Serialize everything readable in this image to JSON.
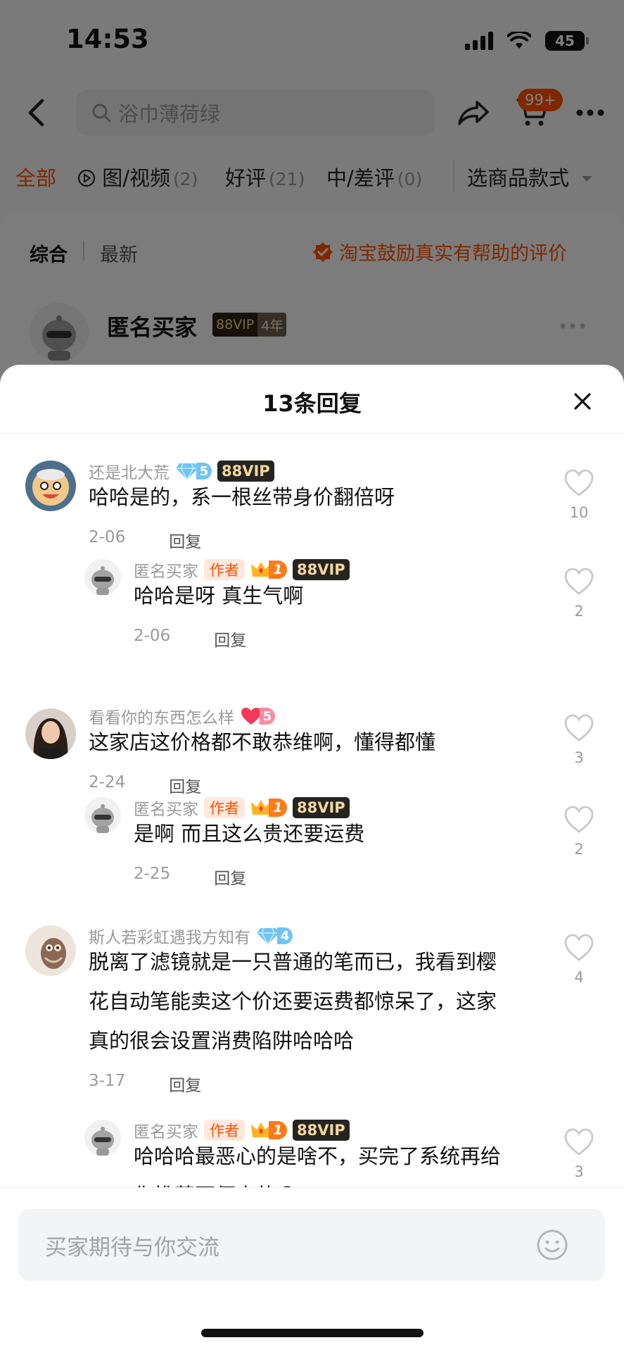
{
  "status_bar": {
    "time": "14:53",
    "battery": "45"
  },
  "nav": {
    "search_placeholder": "浴巾薄荷绿",
    "cart_badge": "99+"
  },
  "filter_tabs": [
    {
      "label": "全部",
      "count": ""
    },
    {
      "label": "图/视频",
      "count": "(2)"
    },
    {
      "label": "好评",
      "count": "(21)"
    },
    {
      "label": "中/差评",
      "count": "(0)"
    }
  ],
  "style_select_label": "选商品款式",
  "sort": {
    "active": "综合",
    "latest": "最新",
    "encourage": "淘宝鼓励真实有帮助的评价"
  },
  "reviewer": {
    "name": "匿名买家",
    "vip": "88VIP",
    "years": "4年"
  },
  "sheet": {
    "title": "13条回复",
    "replies": [
      {
        "user": "还是北大荒",
        "level": "5",
        "level_type": "diamond",
        "vip": "88VIP",
        "author": false,
        "text": "哈哈是的，系一根丝带身价翻倍呀",
        "date": "2-06",
        "reply_label": "回复",
        "likes": "10"
      },
      {
        "user": "匿名买家",
        "author_label": "作者",
        "level": "1",
        "level_type": "crown",
        "vip": "88VIP",
        "author": true,
        "text": "哈哈是呀 真生气啊",
        "date": "2-06",
        "reply_label": "回复",
        "likes": "2"
      },
      {
        "user": "看看你的东西怎么样",
        "level": "5",
        "level_type": "heart",
        "vip": "",
        "author": false,
        "text": "这家店这价格都不敢恭维啊，懂得都懂",
        "date": "2-24",
        "reply_label": "回复",
        "likes": "3"
      },
      {
        "user": "匿名买家",
        "author_label": "作者",
        "level": "1",
        "level_type": "crown",
        "vip": "88VIP",
        "author": true,
        "text": "是啊 而且这么贵还要运费",
        "date": "2-25",
        "reply_label": "回复",
        "likes": "2"
      },
      {
        "user": "斯人若彩虹遇我方知有",
        "level": "4",
        "level_type": "diamond",
        "vip": "",
        "author": false,
        "text_lines": [
          "脱离了滤镜就是一只普通的笔而已，我看到樱",
          "花自动笔能卖这个价还要运费都惊呆了，这家",
          "真的很会设置消费陷阱哈哈哈"
        ],
        "date": "3-17",
        "reply_label": "回复",
        "likes": "4"
      },
      {
        "user": "匿名买家",
        "author_label": "作者",
        "level": "1",
        "level_type": "crown",
        "vip": "88VIP",
        "author": true,
        "text_lines": [
          "哈哈哈最恶心的是啥不，买完了系统再给",
          "你推荐更便宜的😓"
        ],
        "likes": "3"
      }
    ]
  },
  "input": {
    "placeholder": "买家期待与你交流"
  },
  "colors": {
    "accent": "#ff5000",
    "vip_bg": "#262421",
    "vip_text": "#f3d79e",
    "author_tag_bg": "#ffe9df"
  }
}
